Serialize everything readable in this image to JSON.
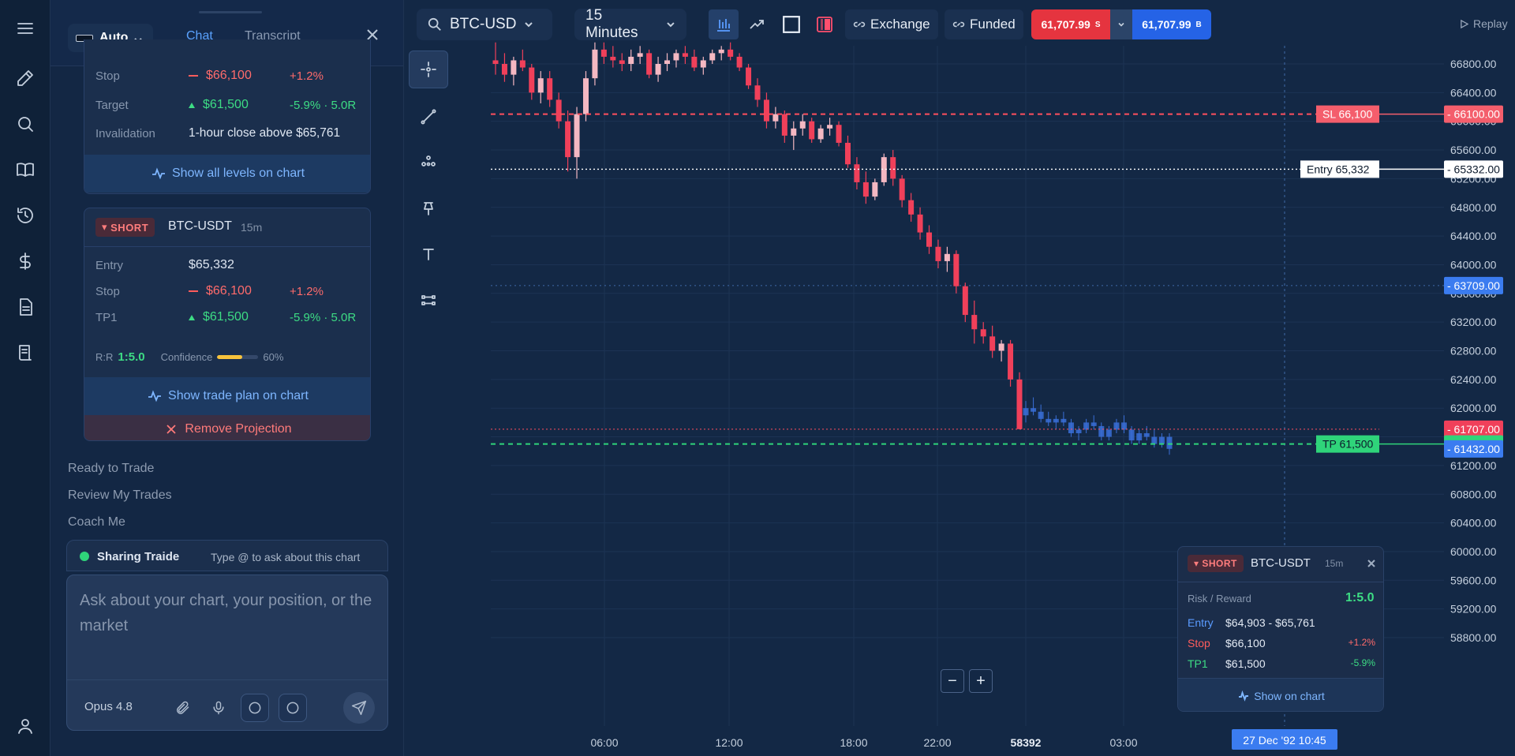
{
  "panel": {
    "model_label": "Auto",
    "tabs": [
      "Chat",
      "Transcript"
    ],
    "card1": {
      "rows": [
        {
          "label": "Stop",
          "value": "$66,100",
          "pct": "+1.2%"
        },
        {
          "label": "Target",
          "value": "$61,500",
          "pct": "-5.9% · 5.0R"
        },
        {
          "label": "Invalidation",
          "value": "1-hour close above $65,761"
        }
      ],
      "action": "Show all levels on chart"
    },
    "card2": {
      "side": "SHORT",
      "symbol": "BTC-USDT",
      "timeframe": "15m",
      "rows": [
        {
          "label": "Entry",
          "value": "$65,332"
        },
        {
          "label": "Stop",
          "value": "$66,100",
          "pct": "+1.2%"
        },
        {
          "label": "TP1",
          "value": "$61,500",
          "pct": "-5.9% · 5.0R"
        }
      ],
      "rr_label": "R:R",
      "rr_value": "1:5.0",
      "confidence_label": "Confidence",
      "confidence_value": "60%",
      "confidence_fraction": 0.6,
      "action": "Show trade plan on chart",
      "remove": "Remove Projection"
    },
    "quick_actions": [
      "Ready to Trade",
      "Review My Trades",
      "Coach Me"
    ],
    "sharing": {
      "title": "Sharing Traide",
      "hint": "Type @ to ask about this chart"
    },
    "composer": {
      "placeholder": "Ask about your chart, your position, or the market",
      "model": "Opus 4.8"
    }
  },
  "toolbar": {
    "symbol": "BTC-USDT",
    "symbol_display": "BTC-USD",
    "interval": "15 Minutes",
    "exchange": "Exchange",
    "funded": "Funded",
    "sell_price": "61,707.99",
    "sell_unit": "S",
    "buy_price": "61,707.99",
    "buy_unit": "B",
    "replay": "Replay"
  },
  "colors": {
    "up": "#f4b8c2",
    "down": "#f0405a",
    "projected": "#3a6fd8",
    "sl": "#ff4f5e",
    "tp": "#2fd47a",
    "accent": "#4b8dff"
  },
  "chart_data": {
    "type": "candlestick",
    "price_axis_ticks": [
      "66800.00",
      "66400.00",
      "66000.00",
      "65600.00",
      "65200.00",
      "64800.00",
      "64400.00",
      "64000.00",
      "63600.00",
      "63200.00",
      "62800.00",
      "62400.00",
      "62000.00",
      "61600.00",
      "61200.00",
      "60800.00",
      "60400.00",
      "60000.00",
      "59600.00",
      "59200.00",
      "58800.00"
    ],
    "ylim": [
      58600,
      67000
    ],
    "time_axis_ticks": [
      "06:00",
      "12:00",
      "18:00",
      "22:00",
      "58392",
      "03:00"
    ],
    "crosshair_time": "27 Dec '92   10:45",
    "levels": [
      {
        "name": "SL",
        "price": 66100,
        "line_label": "SL 66,100",
        "axis_label": "66100.00"
      },
      {
        "name": "Entry",
        "price": 65332,
        "line_label": "Entry 65,332",
        "axis_label": "65332.00"
      },
      {
        "name": "Crosshair",
        "price": 63709,
        "axis_label": "63709.00"
      },
      {
        "name": "Last",
        "price": 61707,
        "axis_label": "61707.00"
      },
      {
        "name": "TP",
        "price": 61500,
        "line_label": "TP 61,500",
        "axis_label": "61500.00"
      },
      {
        "name": "Projected",
        "price": 61432,
        "axis_label": "61432.00"
      }
    ],
    "candles": [
      [
        66850,
        67100,
        66650,
        66800
      ],
      [
        66800,
        66950,
        66550,
        66650
      ],
      [
        66650,
        66900,
        66500,
        66850
      ],
      [
        66850,
        67000,
        66700,
        66750
      ],
      [
        66750,
        66800,
        66300,
        66400
      ],
      [
        66400,
        66700,
        66250,
        66600
      ],
      [
        66600,
        66700,
        66200,
        66300
      ],
      [
        66300,
        66400,
        65900,
        66000
      ],
      [
        66000,
        66150,
        65300,
        65500
      ],
      [
        65500,
        66200,
        65200,
        66100
      ],
      [
        66100,
        66700,
        66000,
        66600
      ],
      [
        66600,
        67100,
        66500,
        67000
      ],
      [
        67000,
        67100,
        66800,
        66900
      ],
      [
        66900,
        67050,
        66750,
        66850
      ],
      [
        66850,
        66950,
        66700,
        66800
      ],
      [
        66800,
        67000,
        66700,
        66900
      ],
      [
        66900,
        67050,
        66800,
        66950
      ],
      [
        66950,
        67000,
        66600,
        66650
      ],
      [
        66650,
        66900,
        66550,
        66800
      ],
      [
        66800,
        66950,
        66700,
        66850
      ],
      [
        66850,
        67000,
        66750,
        66950
      ],
      [
        66950,
        67050,
        66800,
        66900
      ],
      [
        66900,
        67000,
        66700,
        66750
      ],
      [
        66750,
        66900,
        66650,
        66850
      ],
      [
        66850,
        67000,
        66800,
        66950
      ],
      [
        66950,
        67050,
        66850,
        67000
      ],
      [
        67000,
        67100,
        66850,
        66900
      ],
      [
        66900,
        66950,
        66700,
        66750
      ],
      [
        66750,
        66800,
        66450,
        66500
      ],
      [
        66500,
        66600,
        66200,
        66300
      ],
      [
        66300,
        66400,
        65900,
        66000
      ],
      [
        66000,
        66200,
        65900,
        66100
      ],
      [
        66100,
        66150,
        65700,
        65800
      ],
      [
        65800,
        66000,
        65600,
        65900
      ],
      [
        65900,
        66100,
        65800,
        66000
      ],
      [
        66000,
        66050,
        65700,
        65750
      ],
      [
        65750,
        65950,
        65700,
        65900
      ],
      [
        65900,
        66050,
        65800,
        65950
      ],
      [
        65950,
        66000,
        65650,
        65700
      ],
      [
        65700,
        65800,
        65350,
        65400
      ],
      [
        65400,
        65500,
        65050,
        65150
      ],
      [
        65150,
        65300,
        64850,
        64950
      ],
      [
        64950,
        65200,
        64900,
        65150
      ],
      [
        65150,
        65550,
        65100,
        65500
      ],
      [
        65500,
        65600,
        65100,
        65200
      ],
      [
        65200,
        65250,
        64800,
        64900
      ],
      [
        64900,
        65000,
        64600,
        64700
      ],
      [
        64700,
        64800,
        64350,
        64450
      ],
      [
        64450,
        64550,
        64150,
        64250
      ],
      [
        64250,
        64350,
        63950,
        64050
      ],
      [
        64050,
        64250,
        63900,
        64150
      ],
      [
        64150,
        64200,
        63600,
        63700
      ],
      [
        63700,
        63750,
        63200,
        63300
      ],
      [
        63300,
        63500,
        62900,
        63100
      ],
      [
        63100,
        63200,
        62900,
        63000
      ],
      [
        63000,
        63150,
        62700,
        62800
      ],
      [
        62800,
        62950,
        62650,
        62900
      ],
      [
        62900,
        62950,
        62300,
        62400
      ],
      [
        62400,
        62500,
        61800,
        61707
      ]
    ],
    "projected_candles": [
      [
        61900,
        62100,
        61800,
        62000
      ],
      [
        62000,
        62150,
        61900,
        61950
      ],
      [
        61950,
        62050,
        61800,
        61850
      ],
      [
        61850,
        61950,
        61750,
        61800
      ],
      [
        61800,
        61900,
        61700,
        61850
      ],
      [
        61850,
        61950,
        61750,
        61800
      ],
      [
        61800,
        61850,
        61600,
        61650
      ],
      [
        61650,
        61750,
        61550,
        61700
      ],
      [
        61700,
        61850,
        61650,
        61800
      ],
      [
        61800,
        61900,
        61700,
        61750
      ],
      [
        61750,
        61800,
        61550,
        61600
      ],
      [
        61600,
        61750,
        61550,
        61700
      ],
      [
        61700,
        61850,
        61650,
        61800
      ],
      [
        61800,
        61900,
        61650,
        61700
      ],
      [
        61700,
        61750,
        61500,
        61550
      ],
      [
        61550,
        61700,
        61500,
        61650
      ],
      [
        61650,
        61750,
        61550,
        61600
      ],
      [
        61600,
        61700,
        61450,
        61500
      ],
      [
        61500,
        61650,
        61450,
        61600
      ],
      [
        61600,
        61650,
        61350,
        61432
      ]
    ]
  },
  "floating_card": {
    "side": "SHORT",
    "symbol": "BTC-USDT",
    "timeframe": "15m",
    "rr_label": "Risk / Reward",
    "rr_value": "1:5.0",
    "rows": [
      {
        "label": "Entry",
        "value": "$64,903 - $65,761",
        "pct": ""
      },
      {
        "label": "Stop",
        "value": "$66,100",
        "pct": "+1.2%"
      },
      {
        "label": "TP1",
        "value": "$61,500",
        "pct": "-5.9%"
      }
    ],
    "action": "Show on chart"
  },
  "icons": {
    "rail": [
      "menu-icon",
      "pencil-icon",
      "search-icon",
      "book-icon",
      "history-icon",
      "dollar-icon",
      "document-icon",
      "journal-icon",
      "user-icon"
    ],
    "tools": [
      "crosshair-icon",
      "trendline-icon",
      "node-icon",
      "pin-icon",
      "text-icon",
      "pattern-icon"
    ]
  }
}
